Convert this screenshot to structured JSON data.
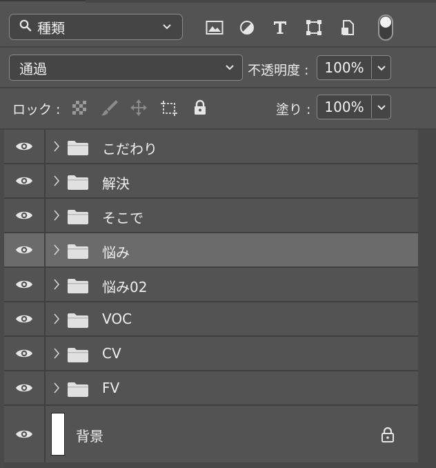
{
  "toolbar": {
    "filter_label": "種類",
    "filter_icons": [
      "image-filter-icon",
      "adjustment-filter-icon",
      "type-filter-icon",
      "shape-filter-icon",
      "smart-object-filter-icon"
    ]
  },
  "blend": {
    "mode": "通過",
    "opacity_label": "不透明度 :",
    "opacity_value": "100%",
    "fill_label": "塗り :",
    "fill_value": "100%"
  },
  "lock": {
    "label": "ロック :",
    "icons": [
      "lock-transparent-pixels-icon",
      "lock-image-pixels-icon",
      "lock-position-icon",
      "lock-artboard-icon",
      "lock-all-icon"
    ]
  },
  "layers": [
    {
      "name": "こだわり",
      "type": "group",
      "selected": false
    },
    {
      "name": "解決",
      "type": "group",
      "selected": false
    },
    {
      "name": "そこで",
      "type": "group",
      "selected": false
    },
    {
      "name": "悩み",
      "type": "group",
      "selected": true
    },
    {
      "name": "悩み02",
      "type": "group",
      "selected": false
    },
    {
      "name": "VOC",
      "type": "group",
      "selected": false
    },
    {
      "name": "CV",
      "type": "group",
      "selected": false
    },
    {
      "name": "FV",
      "type": "group",
      "selected": false
    },
    {
      "name": "背景",
      "type": "background",
      "selected": false,
      "locked": true
    }
  ]
}
